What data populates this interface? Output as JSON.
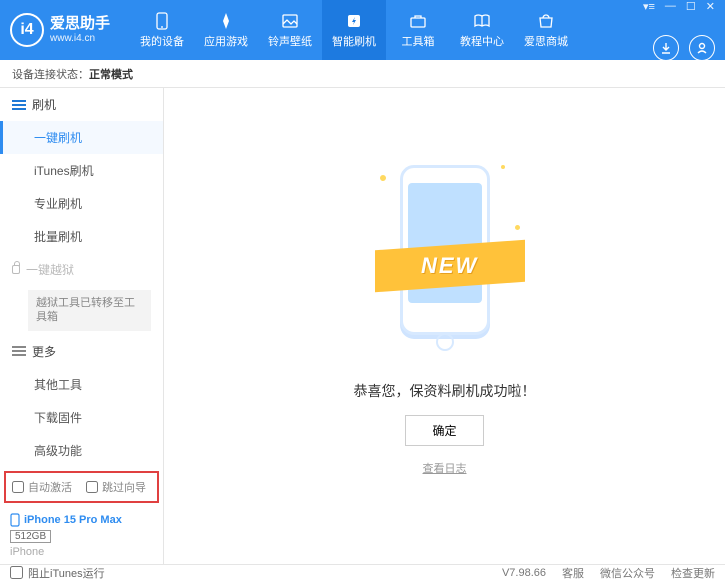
{
  "app": {
    "name": "爱思助手",
    "url": "www.i4.cn"
  },
  "nav": [
    {
      "label": "我的设备"
    },
    {
      "label": "应用游戏"
    },
    {
      "label": "铃声壁纸"
    },
    {
      "label": "智能刷机"
    },
    {
      "label": "工具箱"
    },
    {
      "label": "教程中心"
    },
    {
      "label": "爱思商城"
    }
  ],
  "status": {
    "prefix": "设备连接状态：",
    "mode": "正常模式"
  },
  "sidebar": {
    "group1": {
      "title": "刷机",
      "items": [
        "一键刷机",
        "iTunes刷机",
        "专业刷机",
        "批量刷机"
      ]
    },
    "group2": {
      "title": "一键越狱",
      "note": "越狱工具已转移至工具箱"
    },
    "group3": {
      "title": "更多",
      "items": [
        "其他工具",
        "下载固件",
        "高级功能"
      ]
    },
    "checks": {
      "auto_activate": "自动激活",
      "skip_guide": "跳过向导"
    },
    "device": {
      "name": "iPhone 15 Pro Max",
      "storage": "512GB",
      "type": "iPhone"
    }
  },
  "content": {
    "ribbon": "NEW",
    "message": "恭喜您，保资料刷机成功啦！",
    "ok": "确定",
    "log": "查看日志"
  },
  "footer": {
    "block_itunes": "阻止iTunes运行",
    "version": "V7.98.66",
    "links": [
      "客服",
      "微信公众号",
      "检查更新"
    ]
  }
}
